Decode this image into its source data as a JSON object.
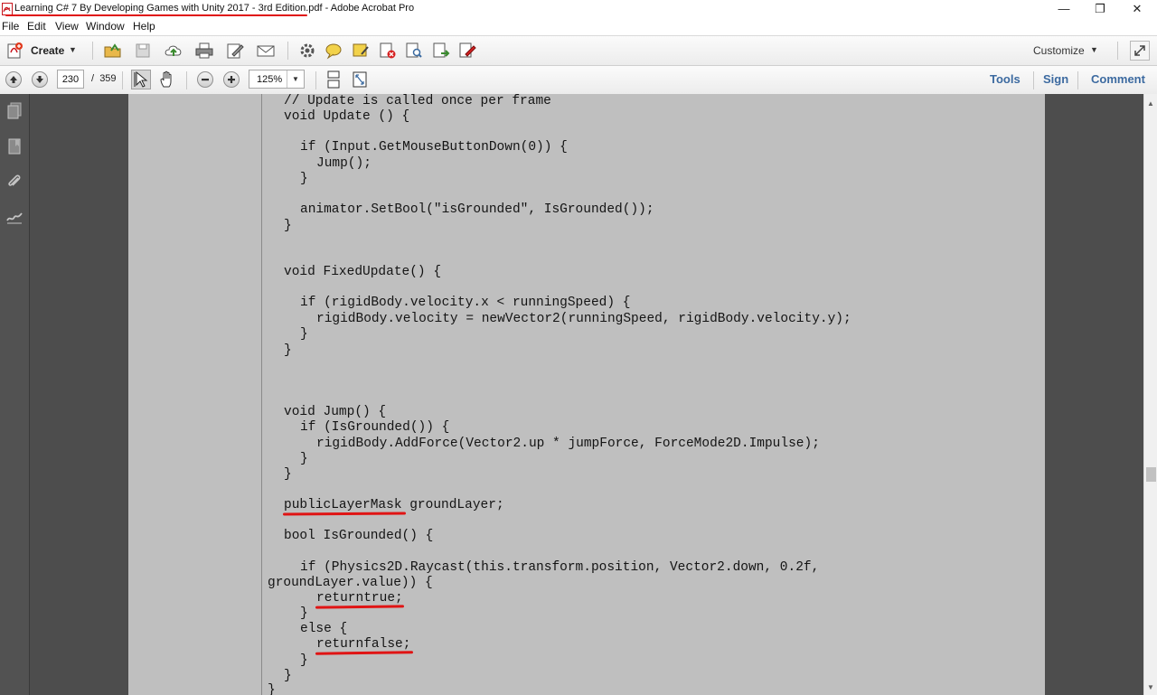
{
  "window": {
    "title": "Learning C# 7 By Developing Games with Unity 2017 - 3rd Edition.pdf - Adobe Acrobat Pro",
    "minimize_glyph": "—",
    "restore_glyph": "❐",
    "close_glyph": "✕"
  },
  "menu": {
    "items": [
      {
        "label": "File"
      },
      {
        "label": "Edit"
      },
      {
        "label": "View"
      },
      {
        "label": "Window"
      },
      {
        "label": "Help"
      }
    ]
  },
  "toolbar": {
    "create_label": "Create",
    "customize_label": "Customize",
    "icons": [
      "open-folder-icon",
      "save-icon",
      "upload-cloud-icon",
      "print-icon",
      "edit-icon",
      "email-icon",
      "settings-icon",
      "comment-bubble-icon",
      "sticky-note-icon",
      "pdf-remove-icon",
      "pdf-search-icon",
      "pdf-export-icon",
      "pdf-form-icon"
    ]
  },
  "navbar": {
    "page_current": "230",
    "page_separator": "/",
    "page_total": "359",
    "zoom_value": "125%",
    "tabs": [
      {
        "label": "Tools"
      },
      {
        "label": "Sign"
      },
      {
        "label": "Comment"
      }
    ]
  },
  "document": {
    "code_lines": [
      "// Update is called once per frame",
      "void Update () {",
      "if (Input.GetMouseButtonDown(0)) {",
      "Jump();",
      "}",
      "animator.SetBool(\"isGrounded\", IsGrounded());",
      "}",
      "void FixedUpdate() {",
      "if (rigidBody.velocity.x < runningSpeed) {",
      "rigidBody.velocity = newVector2(runningSpeed, rigidBody.velocity.y);",
      "}",
      "}",
      "void Jump() {",
      "if (IsGrounded()) {",
      "rigidBody.AddForce(Vector2.up * jumpForce, ForceMode2D.Impulse);",
      "}",
      "}",
      "publicLayerMask groundLayer;",
      "bool IsGrounded() {",
      "if (Physics2D.Raycast(this.transform.position, Vector2.down, 0.2f,",
      "groundLayer.value)) {",
      "returntrue;",
      "}",
      "else {",
      "returnfalse;",
      "}",
      "}",
      "}"
    ]
  }
}
